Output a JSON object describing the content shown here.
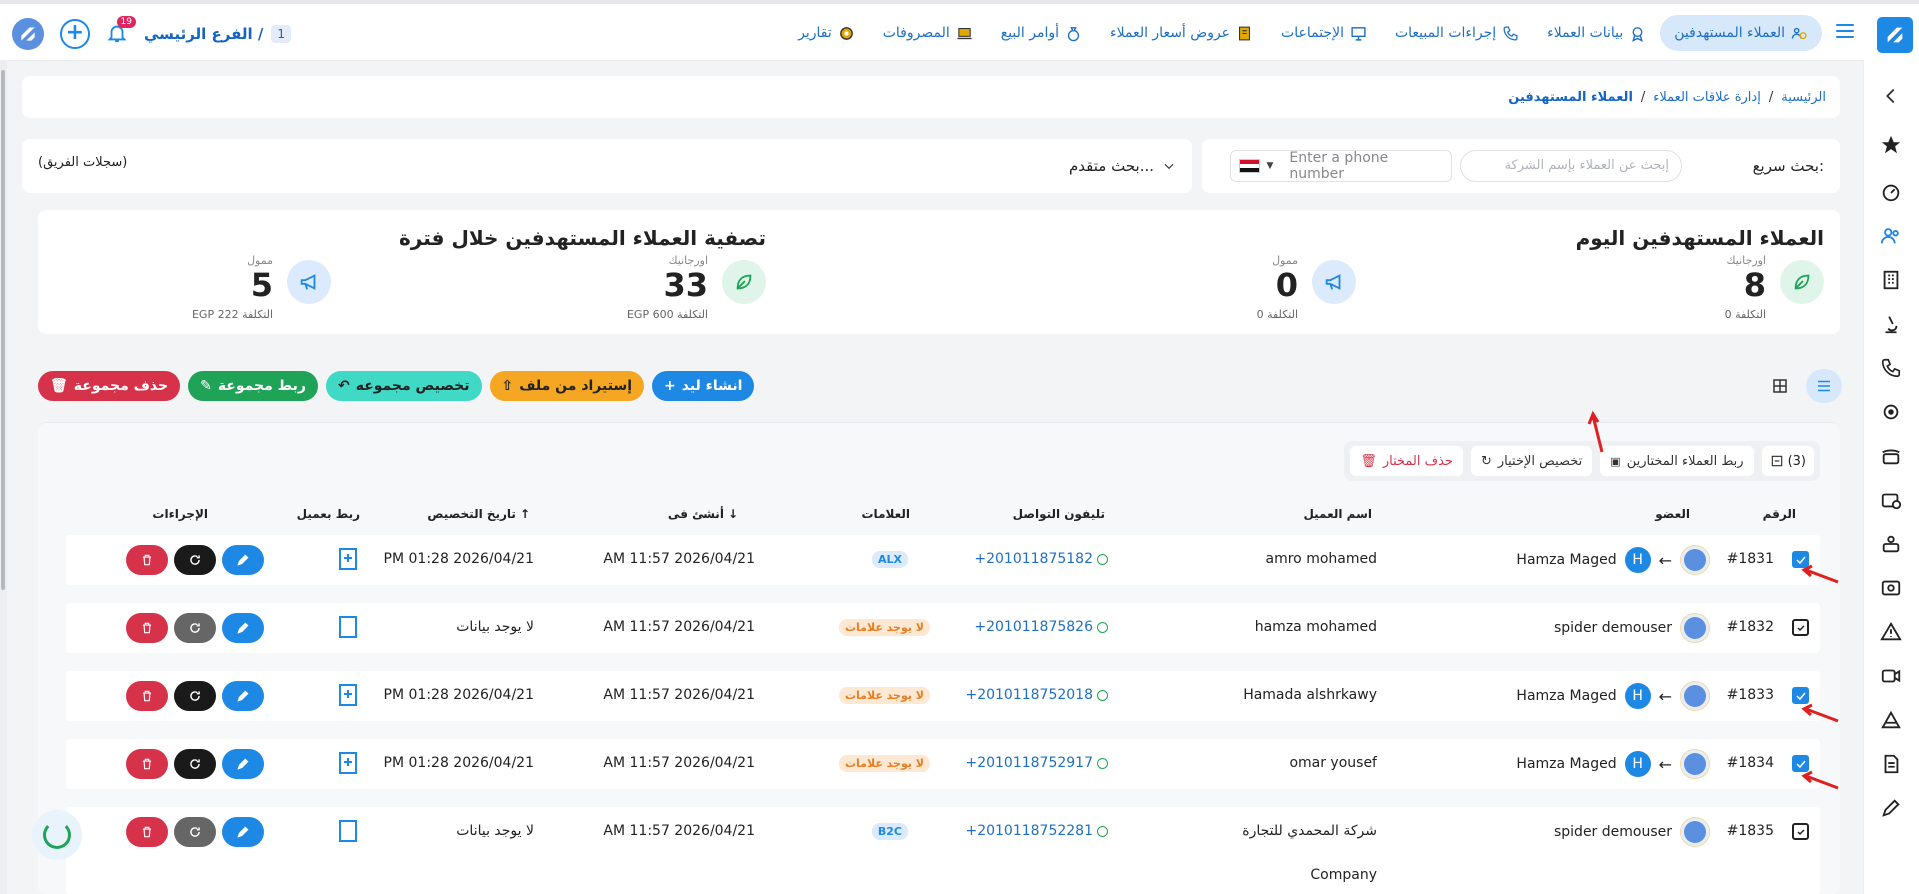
{
  "topbar": {
    "nav": [
      {
        "label": "العملاء المستهدفين",
        "icon": "users-money-icon",
        "active": true
      },
      {
        "label": "بيانات العملاء",
        "icon": "user-badge-icon"
      },
      {
        "label": "إجراءات المبيعات",
        "icon": "phone-icon"
      },
      {
        "label": "الإجتماعات",
        "icon": "presentation-icon"
      },
      {
        "label": "عروض أسعار العملاء",
        "icon": "price-doc-icon"
      },
      {
        "label": "أوامر البيع",
        "icon": "money-bag-icon"
      },
      {
        "label": "المصروفات",
        "icon": "laptop-icon"
      },
      {
        "label": "تقارير",
        "icon": "report-icon"
      }
    ],
    "branch_label": "الفرع الرئيسي /",
    "branch_num": "1",
    "notifications": "19"
  },
  "breadcrumb": {
    "home": "الرئيسية",
    "section": "إدارة علاقات العملاء",
    "current": "العملاء المستهدفين",
    "sep": "/"
  },
  "search": {
    "quick_label": "بحث سريع:",
    "company_placeholder": "إبحث عن العملاء بإسم الشركة",
    "phone_placeholder": "Enter a phone number",
    "advanced_label": "بحث متقدم...",
    "team_logs": "(سجلات الفريق)"
  },
  "stats": {
    "today_title": "العملاء المستهدفين اليوم",
    "period_title": "تصفية العملاء المستهدفين خلال فترة",
    "today_organic": {
      "sub": "اورجانيك",
      "num": "8",
      "cost": "التكلفة 0"
    },
    "today_paid": {
      "sub": "ممول",
      "num": "0",
      "cost": "التكلفة 0"
    },
    "period_organic": {
      "sub": "اورجانيك",
      "num": "33",
      "cost": "EGP 600 التكلفة"
    },
    "period_paid": {
      "sub": "ممول",
      "num": "5",
      "cost": "EGP 222 التكلفة"
    }
  },
  "actions": {
    "create_lead": "انشاء ليد",
    "import": "إستيراد من ملف",
    "assign_group": "تخصيص مجموعه",
    "link_group": "ربط مجموعة",
    "delete_group": "حذف مجموعة"
  },
  "selection": {
    "count": "(3)",
    "link_selected": "ربط العملاء المختارين",
    "assign_selected": "تخصيص الإختيار",
    "delete_selected": "حذف المختار"
  },
  "table": {
    "headers": {
      "num": "الرقم",
      "member": "العضو",
      "client": "اسم العميل",
      "phone": "تليفون التواصل",
      "tags": "العلامات",
      "created": "أنشئ فى",
      "assigned": "تاريخ التخصيص",
      "link": "ربط بعميل",
      "actions": "الإجراءات"
    },
    "rows": [
      {
        "checked": true,
        "num": "#1831",
        "member": "Hamza Maged",
        "assigned_h": true,
        "client": "amro mohamed",
        "phone": "+201011875182",
        "tag": "ALX",
        "tag_style": "blue",
        "created": "AM 11:57 2026/04/21",
        "assigned": "PM 01:28 2026/04/21"
      },
      {
        "checked": false,
        "num": "#1832",
        "member": "spider demouser",
        "assigned_h": false,
        "client": "hamza mohamed",
        "phone": "+201011875826",
        "tag": "لا يوجد علامات",
        "tag_style": "orange",
        "created": "AM 11:57 2026/04/21",
        "assigned": "لا يوجد بيانات"
      },
      {
        "checked": true,
        "num": "#1833",
        "member": "Hamza Maged",
        "assigned_h": true,
        "client": "Hamada alshrkawy",
        "phone": "+2010118752018",
        "tag": "لا يوجد علامات",
        "tag_style": "orange",
        "created": "AM 11:57 2026/04/21",
        "assigned": "PM 01:28 2026/04/21"
      },
      {
        "checked": true,
        "num": "#1834",
        "member": "Hamza Maged",
        "assigned_h": true,
        "client": "omar yousef",
        "phone": "+2010118752917",
        "tag": "لا يوجد علامات",
        "tag_style": "orange",
        "created": "AM 11:57 2026/04/21",
        "assigned": "PM 01:28 2026/04/21"
      },
      {
        "checked": false,
        "num": "#1835",
        "member": "spider demouser",
        "assigned_h": false,
        "client": "شركة المحمدي للتجارة",
        "phone": "+2010118752281",
        "tag": "B2C",
        "tag_style": "blue",
        "created": "AM 11:57 2026/04/21",
        "assigned": "لا يوجد بيانات"
      }
    ],
    "partial_next_client": "Company"
  }
}
